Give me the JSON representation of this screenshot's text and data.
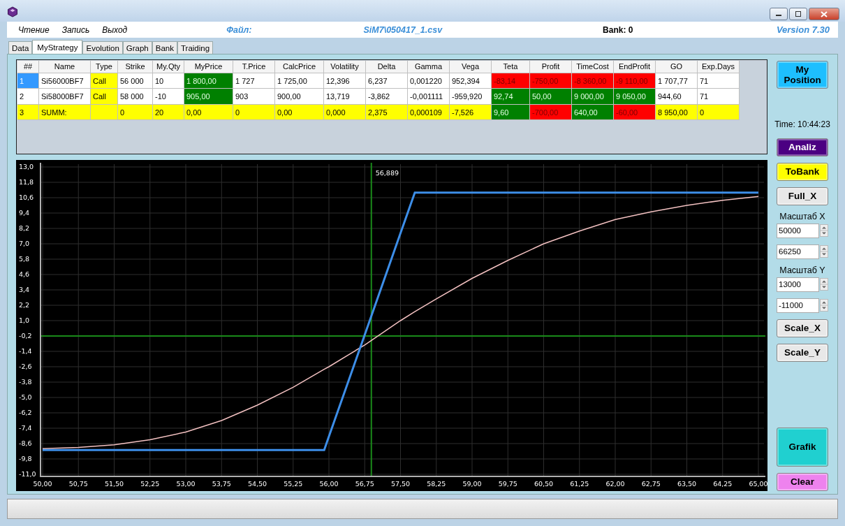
{
  "menu": [
    {
      "label": "Чтение"
    },
    {
      "label": "Запись"
    },
    {
      "label": "Выход"
    }
  ],
  "file_label": "Файл:",
  "file_name": "SiM7\\050417_1.csv",
  "bank": "Bank: 0",
  "version": "Version 7.30",
  "tabs": [
    {
      "label": "Data",
      "selected": false
    },
    {
      "label": "MyStrategy",
      "selected": true
    },
    {
      "label": "Evolution",
      "selected": false
    },
    {
      "label": "Graph",
      "selected": false
    },
    {
      "label": "Bank",
      "selected": false
    },
    {
      "label": "Traiding",
      "selected": false
    }
  ],
  "table": {
    "columns": [
      "##",
      "Name",
      "Type",
      "Strike",
      "My.Qty",
      "MyPrice",
      "T.Price",
      "CalcPrice",
      "Volatility",
      "Delta",
      "Gamma",
      "Vega",
      "Teta",
      "Profit",
      "TimeCost",
      "EndProfit",
      "GO",
      "Exp.Days"
    ],
    "rows": [
      {
        "cells": [
          {
            "text": "1",
            "color": "#3399ff"
          },
          {
            "text": "Si56000BF7",
            "color": "#ffffff"
          },
          {
            "text": "Call",
            "color": "#ffff00"
          },
          {
            "text": "56 000",
            "color": "#ffffff"
          },
          {
            "text": "10",
            "color": "#ffffff"
          },
          {
            "text": "1 800,00",
            "color": "#008000"
          },
          {
            "text": "1 727",
            "color": "#ffffff"
          },
          {
            "text": "1 725,00",
            "color": "#ffffff"
          },
          {
            "text": "12,396",
            "color": "#ffffff"
          },
          {
            "text": "6,237",
            "color": "#ffffff"
          },
          {
            "text": "0,001220",
            "color": "#ffffff"
          },
          {
            "text": "952,394",
            "color": "#ffffff"
          },
          {
            "text": "-83,14",
            "color": "#ff0000"
          },
          {
            "text": "-750,00",
            "color": "#ff0000"
          },
          {
            "text": "-8 360,00",
            "color": "#ff0000"
          },
          {
            "text": "-9 110,00",
            "color": "#ff0000"
          },
          {
            "text": "1 707,77",
            "color": "#ffffff"
          },
          {
            "text": "71",
            "color": "#ffffff"
          }
        ]
      },
      {
        "cells": [
          {
            "text": "2",
            "color": "#ffffff"
          },
          {
            "text": "Si58000BF7",
            "color": "#ffffff"
          },
          {
            "text": "Call",
            "color": "#ffff00"
          },
          {
            "text": "58 000",
            "color": "#ffffff"
          },
          {
            "text": "-10",
            "color": "#ffffff"
          },
          {
            "text": "905,00",
            "color": "#008000"
          },
          {
            "text": "903",
            "color": "#ffffff"
          },
          {
            "text": "900,00",
            "color": "#ffffff"
          },
          {
            "text": "13,719",
            "color": "#ffffff"
          },
          {
            "text": "-3,862",
            "color": "#ffffff"
          },
          {
            "text": "-0,001111",
            "color": "#ffffff"
          },
          {
            "text": "-959,920",
            "color": "#ffffff"
          },
          {
            "text": "92,74",
            "color": "#008000"
          },
          {
            "text": "50,00",
            "color": "#008000"
          },
          {
            "text": "9 000,00",
            "color": "#008000"
          },
          {
            "text": "9 050,00",
            "color": "#008000"
          },
          {
            "text": "944,60",
            "color": "#ffffff"
          },
          {
            "text": "71",
            "color": "#ffffff"
          }
        ]
      },
      {
        "cells": [
          {
            "text": "3",
            "color": "#ffff00"
          },
          {
            "text": "SUMM:",
            "color": "#ffff00"
          },
          {
            "text": "",
            "color": "#ffff00"
          },
          {
            "text": "0",
            "color": "#ffff00"
          },
          {
            "text": "20",
            "color": "#ffff00"
          },
          {
            "text": "0,00",
            "color": "#ffff00"
          },
          {
            "text": "0",
            "color": "#ffff00"
          },
          {
            "text": "0,00",
            "color": "#ffff00"
          },
          {
            "text": "0,000",
            "color": "#ffff00"
          },
          {
            "text": "2,375",
            "color": "#ffff00"
          },
          {
            "text": "0,000109",
            "color": "#ffff00"
          },
          {
            "text": "-7,526",
            "color": "#ffff00"
          },
          {
            "text": "9,60",
            "color": "#008000"
          },
          {
            "text": "-700,00",
            "color": "#ff0000"
          },
          {
            "text": "640,00",
            "color": "#008000"
          },
          {
            "text": "-60,00",
            "color": "#ff0000"
          },
          {
            "text": "8 950,00",
            "color": "#ffff00"
          },
          {
            "text": "0",
            "color": "#ffff00"
          }
        ]
      }
    ]
  },
  "chart": {
    "chart_data": {
      "type": "line",
      "x": [
        50,
        50.75,
        51.5,
        52.25,
        53,
        53.75,
        54.5,
        55.25,
        55.9,
        56,
        56.75,
        57.5,
        57.8,
        58.25,
        59,
        59.75,
        60.5,
        61.25,
        62,
        62.75,
        63.5,
        64.25,
        65
      ],
      "series": [
        {
          "color": "#f4c2c2",
          "values": [
            -9.0,
            -8.9,
            -8.7,
            -8.3,
            -7.7,
            -6.8,
            -5.6,
            -4.2,
            -2.8,
            -2.6,
            -0.9,
            1.0,
            1.7,
            2.7,
            4.3,
            5.7,
            7.0,
            8.0,
            8.9,
            9.5,
            10.0,
            10.4,
            10.7
          ]
        },
        {
          "color": "#3d8ee8",
          "values": [
            -9.1,
            -9.1,
            -9.1,
            -9.1,
            -9.1,
            -9.1,
            -9.1,
            -9.1,
            -9.1,
            -8.04,
            -0.11,
            7.83,
            11.0,
            11.0,
            11.0,
            11.0,
            11.0,
            11.0,
            11.0,
            11.0,
            11.0,
            11.0,
            11.0
          ]
        }
      ],
      "xlim": [
        50,
        65
      ],
      "ylim": [
        -11,
        13
      ],
      "xticks": [
        {
          "value": 50,
          "label": "50,00"
        },
        {
          "value": 50.75,
          "label": "50,75"
        },
        {
          "value": 51.5,
          "label": "51,50"
        },
        {
          "value": 52.25,
          "label": "52,25"
        },
        {
          "value": 53,
          "label": "53,00"
        },
        {
          "value": 53.75,
          "label": "53,75"
        },
        {
          "value": 54.5,
          "label": "54,50"
        },
        {
          "value": 55.25,
          "label": "55,25"
        },
        {
          "value": 56,
          "label": "56,00"
        },
        {
          "value": 56.75,
          "label": "56,75"
        },
        {
          "value": 57.5,
          "label": "57,50"
        },
        {
          "value": 58.25,
          "label": "58,25"
        },
        {
          "value": 59,
          "label": "59,00"
        },
        {
          "value": 59.75,
          "label": "59,75"
        },
        {
          "value": 60.5,
          "label": "60,50"
        },
        {
          "value": 61.25,
          "label": "61,25"
        },
        {
          "value": 62,
          "label": "62,00"
        },
        {
          "value": 62.75,
          "label": "62,75"
        },
        {
          "value": 63.5,
          "label": "63,50"
        },
        {
          "value": 64.25,
          "label": "64,25"
        },
        {
          "value": 65,
          "label": "65,00"
        }
      ],
      "yticks": [
        {
          "value": 13,
          "label": "13,0"
        },
        {
          "value": 11.8,
          "label": "11,8"
        },
        {
          "value": 10.6,
          "label": "10,6"
        },
        {
          "value": 9.4,
          "label": "9,4"
        },
        {
          "value": 8.2,
          "label": "8,2"
        },
        {
          "value": 7,
          "label": "7,0"
        },
        {
          "value": 5.8,
          "label": "5,8"
        },
        {
          "value": 4.6,
          "label": "4,6"
        },
        {
          "value": 3.4,
          "label": "3,4"
        },
        {
          "value": 2.2,
          "label": "2,2"
        },
        {
          "value": 1,
          "label": "1,0"
        },
        {
          "value": -0.2,
          "label": "-0,2"
        },
        {
          "value": -1.4,
          "label": "-1,4"
        },
        {
          "value": -2.6,
          "label": "-2,6"
        },
        {
          "value": -3.8,
          "label": "-3,8"
        },
        {
          "value": -5,
          "label": "-5,0"
        },
        {
          "value": -6.2,
          "label": "-6,2"
        },
        {
          "value": -7.4,
          "label": "-7,4"
        },
        {
          "value": -8.6,
          "label": "-8,6"
        },
        {
          "value": -9.8,
          "label": "-9,8"
        },
        {
          "value": -11,
          "label": "-11,0"
        }
      ],
      "grid": true,
      "ref_lines": [
        {
          "axis": "x",
          "value": 56.889,
          "label": "56,889",
          "color": "#1a8a1a"
        },
        {
          "axis": "y",
          "value": -0.2,
          "color": "#1a8a1a"
        }
      ]
    }
  },
  "side_panel": {
    "position_button": {
      "label": "My Position",
      "color": "#1ebfff"
    },
    "time": "Time: 10:44:23",
    "controls": [
      {
        "kind": "button",
        "label": "Analiz",
        "color": "#4b0082"
      },
      {
        "kind": "button",
        "label": "ToBank",
        "color": "#ffff00"
      },
      {
        "kind": "button",
        "label": "Full_X",
        "color": "#e8e8e8"
      },
      {
        "kind": "label",
        "label": "Масштаб X"
      },
      {
        "kind": "spinner",
        "value": "50000"
      },
      {
        "kind": "spinner",
        "value": "66250"
      },
      {
        "kind": "label",
        "label": "Масштаб Y"
      },
      {
        "kind": "spinner",
        "value": "13000"
      },
      {
        "kind": "spinner",
        "value": "-11000"
      },
      {
        "kind": "button",
        "label": "Scale_X",
        "color": "#e8e8e8"
      },
      {
        "kind": "button",
        "label": "Scale_Y",
        "color": "#e8e8e8"
      }
    ],
    "bottom_buttons": [
      {
        "kind": "large",
        "label": "Grafik",
        "color": "#20d0d0"
      },
      {
        "kind": "normal",
        "label": "Clear",
        "color": "#ee82ee"
      }
    ]
  }
}
